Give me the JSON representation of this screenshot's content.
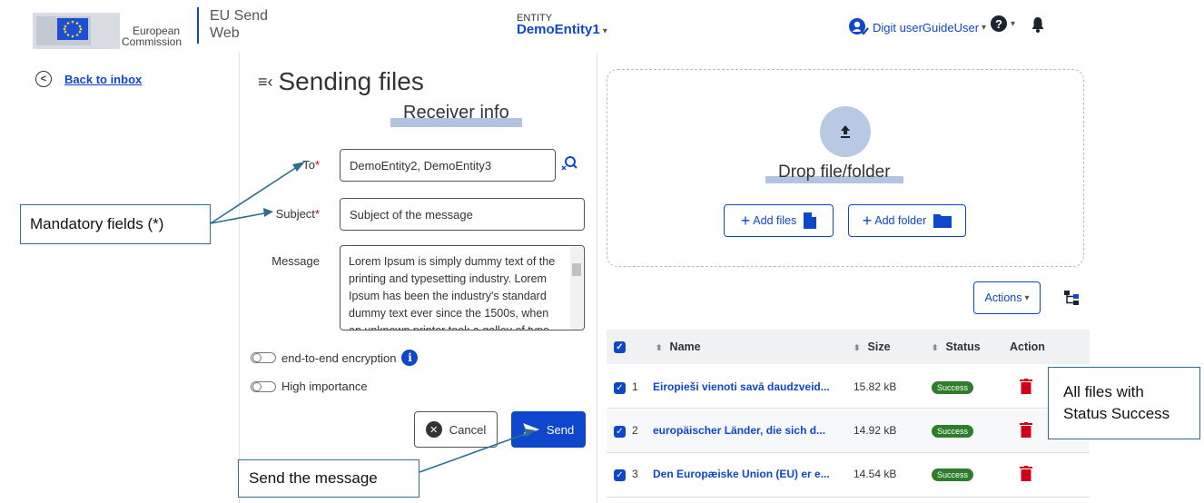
{
  "colors": {
    "accent": "#0e47cb",
    "success": "#2d7d2a",
    "danger": "#d0021b",
    "callout_border": "#2e6e8f"
  },
  "header": {
    "org_line1": "European",
    "org_line2": "Commission",
    "app_line1": "EU Send",
    "app_line2": "Web",
    "entity_caption": "ENTITY",
    "entity_value": "DemoEntity1",
    "user_name": "Digit userGuideUser",
    "icons": [
      "eu-flag-logo",
      "user-icon",
      "help-icon",
      "bell-icon"
    ]
  },
  "nav": {
    "back_label": "Back to inbox"
  },
  "form": {
    "title": "Sending files",
    "section": "Receiver info",
    "to_label": "To",
    "to_value": "DemoEntity2, DemoEntity3",
    "subject_label": "Subject",
    "subject_value": "Subject of the message",
    "message_label": "Message",
    "message_value": "Lorem Ipsum is simply dummy text of the printing and typesetting industry. Lorem Ipsum has been the industry's standard dummy text ever since the 1500s, when an unknown printer took a galley of type",
    "required_mark": "*",
    "encryption_label": "end-to-end encryption",
    "importance_label": "High importance",
    "cancel_label": "Cancel",
    "send_label": "Send"
  },
  "upload": {
    "drop_text": "Drop file/folder",
    "add_files_label": "Add files",
    "add_folder_label": "Add folder",
    "actions_label": "Actions"
  },
  "table": {
    "headers": {
      "name": "Name",
      "size": "Size",
      "status": "Status",
      "action": "Action"
    },
    "rows": [
      {
        "index": "1",
        "name": "Eiropieši vienoti savā daudzveid...",
        "size": "15.82 kB",
        "status": "Success"
      },
      {
        "index": "2",
        "name": "europäischer Länder, die sich d...",
        "size": "14.92 kB",
        "status": "Success"
      },
      {
        "index": "3",
        "name": "Den Europæiske Union (EU) er e...",
        "size": "14.54 kB",
        "status": "Success"
      }
    ]
  },
  "callouts": {
    "mandatory": "Mandatory fields (*)",
    "send": "Send the message",
    "status_line1": "All files with",
    "status_line2": "Status Success"
  }
}
